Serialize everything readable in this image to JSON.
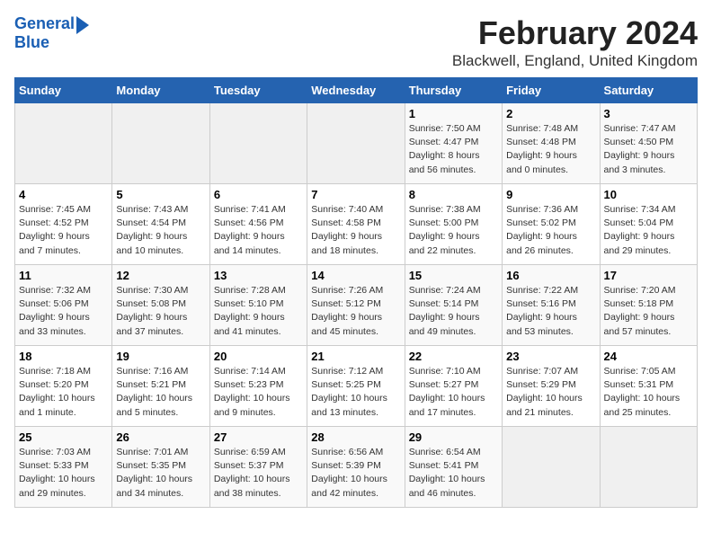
{
  "header": {
    "logo_line1": "General",
    "logo_line2": "Blue",
    "title": "February 2024",
    "subtitle": "Blackwell, England, United Kingdom"
  },
  "days_of_week": [
    "Sunday",
    "Monday",
    "Tuesday",
    "Wednesday",
    "Thursday",
    "Friday",
    "Saturday"
  ],
  "weeks": [
    [
      {
        "day": "",
        "info": ""
      },
      {
        "day": "",
        "info": ""
      },
      {
        "day": "",
        "info": ""
      },
      {
        "day": "",
        "info": ""
      },
      {
        "day": "1",
        "info": "Sunrise: 7:50 AM\nSunset: 4:47 PM\nDaylight: 8 hours\nand 56 minutes."
      },
      {
        "day": "2",
        "info": "Sunrise: 7:48 AM\nSunset: 4:48 PM\nDaylight: 9 hours\nand 0 minutes."
      },
      {
        "day": "3",
        "info": "Sunrise: 7:47 AM\nSunset: 4:50 PM\nDaylight: 9 hours\nand 3 minutes."
      }
    ],
    [
      {
        "day": "4",
        "info": "Sunrise: 7:45 AM\nSunset: 4:52 PM\nDaylight: 9 hours\nand 7 minutes."
      },
      {
        "day": "5",
        "info": "Sunrise: 7:43 AM\nSunset: 4:54 PM\nDaylight: 9 hours\nand 10 minutes."
      },
      {
        "day": "6",
        "info": "Sunrise: 7:41 AM\nSunset: 4:56 PM\nDaylight: 9 hours\nand 14 minutes."
      },
      {
        "day": "7",
        "info": "Sunrise: 7:40 AM\nSunset: 4:58 PM\nDaylight: 9 hours\nand 18 minutes."
      },
      {
        "day": "8",
        "info": "Sunrise: 7:38 AM\nSunset: 5:00 PM\nDaylight: 9 hours\nand 22 minutes."
      },
      {
        "day": "9",
        "info": "Sunrise: 7:36 AM\nSunset: 5:02 PM\nDaylight: 9 hours\nand 26 minutes."
      },
      {
        "day": "10",
        "info": "Sunrise: 7:34 AM\nSunset: 5:04 PM\nDaylight: 9 hours\nand 29 minutes."
      }
    ],
    [
      {
        "day": "11",
        "info": "Sunrise: 7:32 AM\nSunset: 5:06 PM\nDaylight: 9 hours\nand 33 minutes."
      },
      {
        "day": "12",
        "info": "Sunrise: 7:30 AM\nSunset: 5:08 PM\nDaylight: 9 hours\nand 37 minutes."
      },
      {
        "day": "13",
        "info": "Sunrise: 7:28 AM\nSunset: 5:10 PM\nDaylight: 9 hours\nand 41 minutes."
      },
      {
        "day": "14",
        "info": "Sunrise: 7:26 AM\nSunset: 5:12 PM\nDaylight: 9 hours\nand 45 minutes."
      },
      {
        "day": "15",
        "info": "Sunrise: 7:24 AM\nSunset: 5:14 PM\nDaylight: 9 hours\nand 49 minutes."
      },
      {
        "day": "16",
        "info": "Sunrise: 7:22 AM\nSunset: 5:16 PM\nDaylight: 9 hours\nand 53 minutes."
      },
      {
        "day": "17",
        "info": "Sunrise: 7:20 AM\nSunset: 5:18 PM\nDaylight: 9 hours\nand 57 minutes."
      }
    ],
    [
      {
        "day": "18",
        "info": "Sunrise: 7:18 AM\nSunset: 5:20 PM\nDaylight: 10 hours\nand 1 minute."
      },
      {
        "day": "19",
        "info": "Sunrise: 7:16 AM\nSunset: 5:21 PM\nDaylight: 10 hours\nand 5 minutes."
      },
      {
        "day": "20",
        "info": "Sunrise: 7:14 AM\nSunset: 5:23 PM\nDaylight: 10 hours\nand 9 minutes."
      },
      {
        "day": "21",
        "info": "Sunrise: 7:12 AM\nSunset: 5:25 PM\nDaylight: 10 hours\nand 13 minutes."
      },
      {
        "day": "22",
        "info": "Sunrise: 7:10 AM\nSunset: 5:27 PM\nDaylight: 10 hours\nand 17 minutes."
      },
      {
        "day": "23",
        "info": "Sunrise: 7:07 AM\nSunset: 5:29 PM\nDaylight: 10 hours\nand 21 minutes."
      },
      {
        "day": "24",
        "info": "Sunrise: 7:05 AM\nSunset: 5:31 PM\nDaylight: 10 hours\nand 25 minutes."
      }
    ],
    [
      {
        "day": "25",
        "info": "Sunrise: 7:03 AM\nSunset: 5:33 PM\nDaylight: 10 hours\nand 29 minutes."
      },
      {
        "day": "26",
        "info": "Sunrise: 7:01 AM\nSunset: 5:35 PM\nDaylight: 10 hours\nand 34 minutes."
      },
      {
        "day": "27",
        "info": "Sunrise: 6:59 AM\nSunset: 5:37 PM\nDaylight: 10 hours\nand 38 minutes."
      },
      {
        "day": "28",
        "info": "Sunrise: 6:56 AM\nSunset: 5:39 PM\nDaylight: 10 hours\nand 42 minutes."
      },
      {
        "day": "29",
        "info": "Sunrise: 6:54 AM\nSunset: 5:41 PM\nDaylight: 10 hours\nand 46 minutes."
      },
      {
        "day": "",
        "info": ""
      },
      {
        "day": "",
        "info": ""
      }
    ]
  ]
}
